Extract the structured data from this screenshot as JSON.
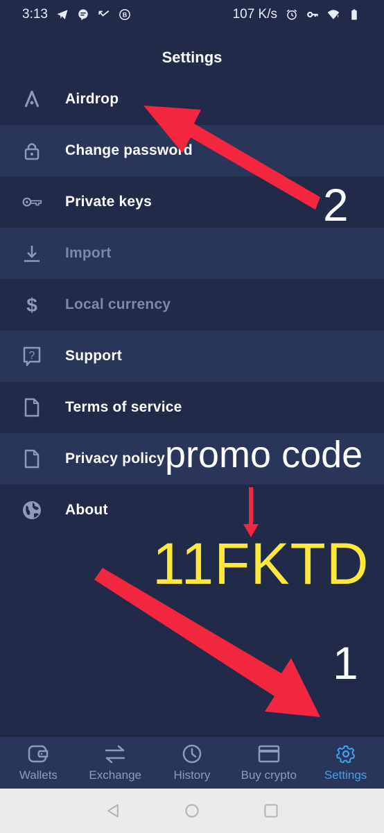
{
  "status_bar": {
    "time": "3:13",
    "network_speed": "107 K/s",
    "left_icons": [
      "telegram-icon",
      "chat-bubble-icon",
      "missed-call-icon",
      "b-badge-icon"
    ],
    "right_icons": [
      "alarm-icon",
      "vpn-key-icon",
      "wifi-alert-icon",
      "battery-icon"
    ]
  },
  "header": {
    "title": "Settings"
  },
  "menu": {
    "items": [
      {
        "label": "Airdrop",
        "icon": "airdrop-icon",
        "enabled": true
      },
      {
        "label": "Change password",
        "icon": "lock-icon",
        "enabled": true
      },
      {
        "label": "Private keys",
        "icon": "key-icon",
        "enabled": true
      },
      {
        "label": "Import",
        "icon": "download-icon",
        "enabled": false
      },
      {
        "label": "Local currency",
        "icon": "dollar-icon",
        "enabled": false
      },
      {
        "label": "Support",
        "icon": "help-bubble-icon",
        "enabled": true
      },
      {
        "label": "Terms of service",
        "icon": "document-icon",
        "enabled": true
      },
      {
        "label": "Privacy policy",
        "icon": "document-icon",
        "enabled": true
      },
      {
        "label": "About",
        "icon": "globe-icon",
        "enabled": true
      }
    ]
  },
  "annotations": {
    "promo_label": "promo code",
    "promo_code": "11FKTD",
    "step_1": "1",
    "step_2": "2",
    "arrow_color": "#f2263f",
    "code_color": "#ffe83a"
  },
  "bottom_nav": {
    "items": [
      {
        "label": "Wallets",
        "icon": "wallet-icon",
        "active": false
      },
      {
        "label": "Exchange",
        "icon": "exchange-arrows-icon",
        "active": false
      },
      {
        "label": "History",
        "icon": "clock-icon",
        "active": false
      },
      {
        "label": "Buy crypto",
        "icon": "credit-card-icon",
        "active": false
      },
      {
        "label": "Settings",
        "icon": "gear-icon",
        "active": true
      }
    ],
    "active_color": "#3ea1f2",
    "inactive_color": "#8e9ab9"
  },
  "system_nav": {
    "buttons": [
      "back-icon",
      "home-icon",
      "recents-icon"
    ]
  }
}
